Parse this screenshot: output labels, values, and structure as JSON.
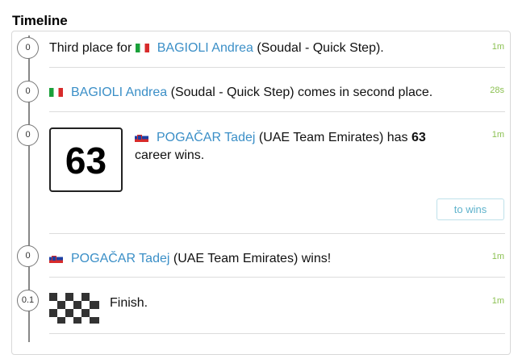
{
  "title": "Timeline",
  "events": [
    {
      "km": "0",
      "time": "1m",
      "prefix": "Third place for ",
      "flag": "it",
      "rider": "BAGIOLI Andrea",
      "team": " (Soudal - Quick Step)."
    },
    {
      "km": "0",
      "time": "28s",
      "flag": "it",
      "rider": "BAGIOLI Andrea",
      "team": " (Soudal - Quick Step) comes in second place."
    },
    {
      "km": "0",
      "time": "1m",
      "wins_number": "63",
      "flag": "si",
      "rider": "POGAČAR Tadej",
      "team": " (UAE Team Emirates) has ",
      "wins_bold": "63",
      "line2": "career wins.",
      "button": "to wins"
    },
    {
      "km": "0",
      "time": "1m",
      "flag": "si",
      "rider": "POGAČAR Tadej",
      "team": " (UAE Team Emirates) wins!"
    },
    {
      "km": "0.1",
      "time": "1m",
      "text": "Finish."
    }
  ],
  "colors": {
    "rider_link": "#3b8fc7",
    "time": "#8cc152"
  },
  "icons": {
    "finish": "checkered-flag-icon"
  }
}
